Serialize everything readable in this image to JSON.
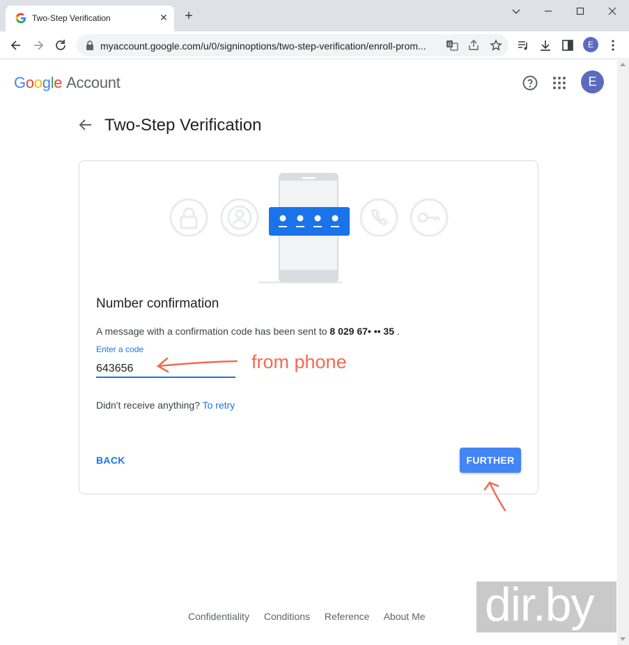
{
  "browser": {
    "tab_title": "Two-Step Verification",
    "url": "myaccount.google.com/u/0/signinoptions/two-step-verification/enroll-prom...",
    "profile_initial": "E"
  },
  "header": {
    "logo_letters": [
      "G",
      "o",
      "o",
      "g",
      "l",
      "e"
    ],
    "logo_suffix": "Account",
    "avatar_initial": "E"
  },
  "main": {
    "title": "Two-Step Verification"
  },
  "card": {
    "heading": "Number confirmation",
    "message_prefix": "A message with a confirmation code has been sent to",
    "phone": "8 029 67• •• 35",
    "message_suffix": ".",
    "code_label": "Enter a code",
    "code_value": "643656",
    "retry_text": "Didn't receive anything?",
    "retry_link": "To retry",
    "back_label": "BACK",
    "further_label": "FURTHER",
    "code_dots": [
      "•",
      "•",
      "•",
      "•"
    ]
  },
  "annotation": {
    "text": "from phone",
    "color": "#f26a4f"
  },
  "footer": {
    "links": [
      "Confidentiality",
      "Conditions",
      "Reference",
      "About Me"
    ]
  },
  "watermark": {
    "text": "dir.by"
  },
  "colors": {
    "accent": "#1a73e8",
    "button": "#4285f4",
    "avatar": "#5c6bc0"
  }
}
